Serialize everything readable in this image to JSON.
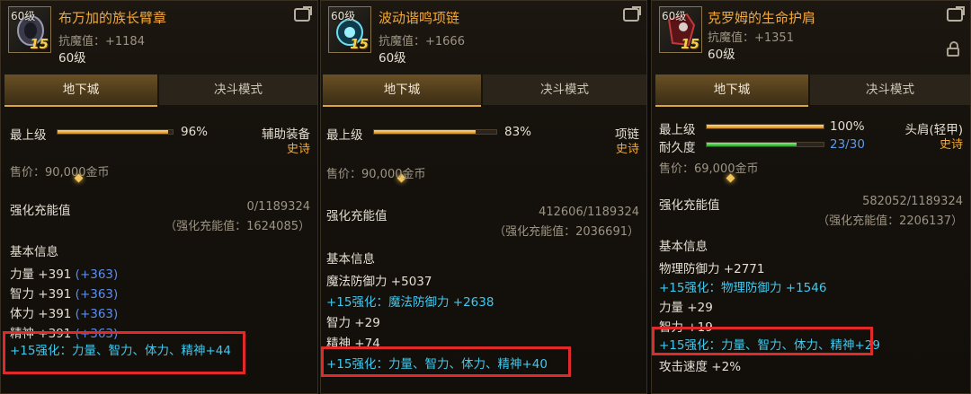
{
  "items": [
    {
      "level_tag": "60级",
      "plus": "15",
      "name": "布万加的族长臂章",
      "resist": "抗魔值：+1184",
      "level": "60级",
      "tabs": [
        "地下城",
        "决斗模式"
      ],
      "top_label": "最上级",
      "top_pct": "96%",
      "top_fill": 0.96,
      "slot": "辅助装备",
      "rarity": "史诗",
      "price": "售价：90,000金币",
      "charge_label": "强化充能值",
      "charge_value": "0/1189324",
      "charge_sub": "（强化充能值：1624085）",
      "basic_title": "基本信息",
      "stats": [
        {
          "text": "力量 +391",
          "extra": "(+363)"
        },
        {
          "text": "智力 +391",
          "extra": "(+363)"
        },
        {
          "text": "体力 +391",
          "extra": "(+363)"
        },
        {
          "text": "精神 +391",
          "extra": "(+363)"
        }
      ],
      "enhance": "+15强化：力量、智力、体力、精神+44"
    },
    {
      "level_tag": "60级",
      "plus": "15",
      "name": "波动谐鸣项链",
      "resist": "抗魔值：+1666",
      "level": "60级",
      "tabs": [
        "地下城",
        "决斗模式"
      ],
      "top_label": "最上级",
      "top_pct": "83%",
      "top_fill": 0.83,
      "slot": "项链",
      "rarity": "史诗",
      "price": "售价：90,000金币",
      "charge_label": "强化充能值",
      "charge_value": "412606/1189324",
      "charge_sub": "（强化充能值：2036691）",
      "basic_title": "基本信息",
      "lines": [
        {
          "text": "魔法防御力 +5037",
          "style": "white"
        },
        {
          "text": "+15强化：魔法防御力 +2638",
          "style": "cyan"
        },
        {
          "text": "智力 +29",
          "style": "white"
        },
        {
          "text": "精神 +74",
          "style": "white"
        }
      ],
      "enhance": "+15强化：力量、智力、体力、精神+40"
    },
    {
      "level_tag": "60级",
      "plus": "15",
      "name": "克罗姆的生命护肩",
      "resist": "抗魔值：+1351",
      "level": "60级",
      "tabs": [
        "地下城",
        "决斗模式"
      ],
      "top_label": "最上级",
      "top_pct": "100%",
      "top_fill": 1.0,
      "dur_label": "耐久度",
      "dur_value": "23/30",
      "dur_fill": 0.77,
      "slot": "头肩(轻甲)",
      "rarity": "史诗",
      "price": "售价：69,000金币",
      "charge_label": "强化充能值",
      "charge_value": "582052/1189324",
      "charge_sub": "（强化充能值：2206137）",
      "basic_title": "基本信息",
      "lines": [
        {
          "text": "物理防御力 +2771",
          "style": "white"
        },
        {
          "text": "+15强化：物理防御力 +1546",
          "style": "cyan"
        },
        {
          "text": "力量 +29",
          "style": "white"
        },
        {
          "text": "智力 +19",
          "style": "white"
        }
      ],
      "enhance": "+15强化：力量、智力、体力、精神+29",
      "after": "攻击速度 +2%"
    }
  ]
}
